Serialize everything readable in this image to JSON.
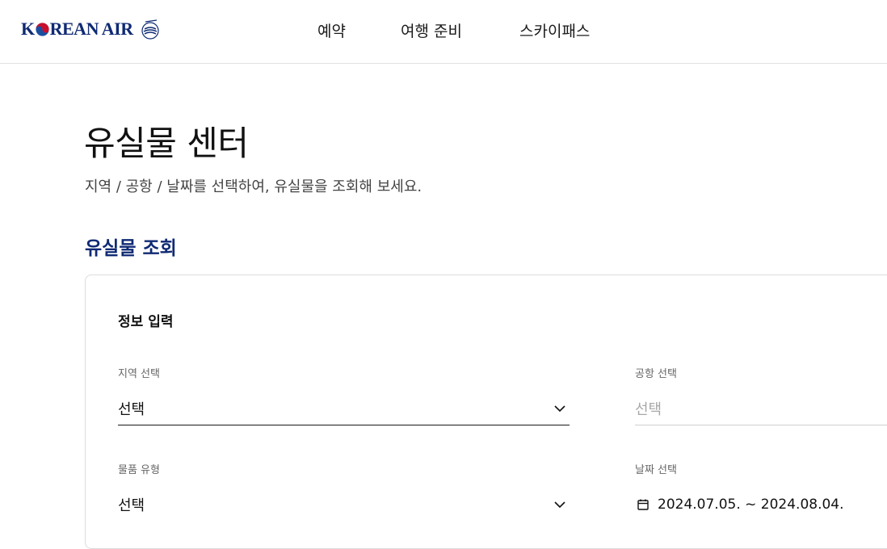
{
  "header": {
    "logo_text_left": "K",
    "logo_text_right": "REAN AIR",
    "logo_alt": "KOREAN AIR",
    "skyteam_text": "SKYTEAM",
    "nav": [
      {
        "label": "예약"
      },
      {
        "label": "여행 준비"
      },
      {
        "label": "스카이패스"
      }
    ]
  },
  "main": {
    "title": "유실물 센터",
    "subtitle": "지역 / 공항 / 날짜를 선택하여, 유실물을 조회해 보세요.",
    "section_title": "유실물 조회",
    "card": {
      "title": "정보 입력",
      "fields": {
        "region": {
          "label": "지역 선택",
          "value": "선택"
        },
        "airport": {
          "label": "공항 선택",
          "value": "선택"
        },
        "item_type": {
          "label": "물품 유형",
          "value": "선택"
        },
        "date": {
          "label": "날짜 선택",
          "value": "2024.07.05. ~ 2024.08.04."
        }
      }
    }
  },
  "colors": {
    "brand_navy": "#0f2a73",
    "brand_red": "#c8102e",
    "brand_blue": "#1a4fa0",
    "text": "#111111",
    "muted": "#666666",
    "placeholder": "#a8a8a8"
  },
  "icons": {
    "calendar": "calendar-icon",
    "dropdown": "chevron-down-icon",
    "logo": "taegeuk-icon",
    "skyteam": "skyteam-icon"
  }
}
